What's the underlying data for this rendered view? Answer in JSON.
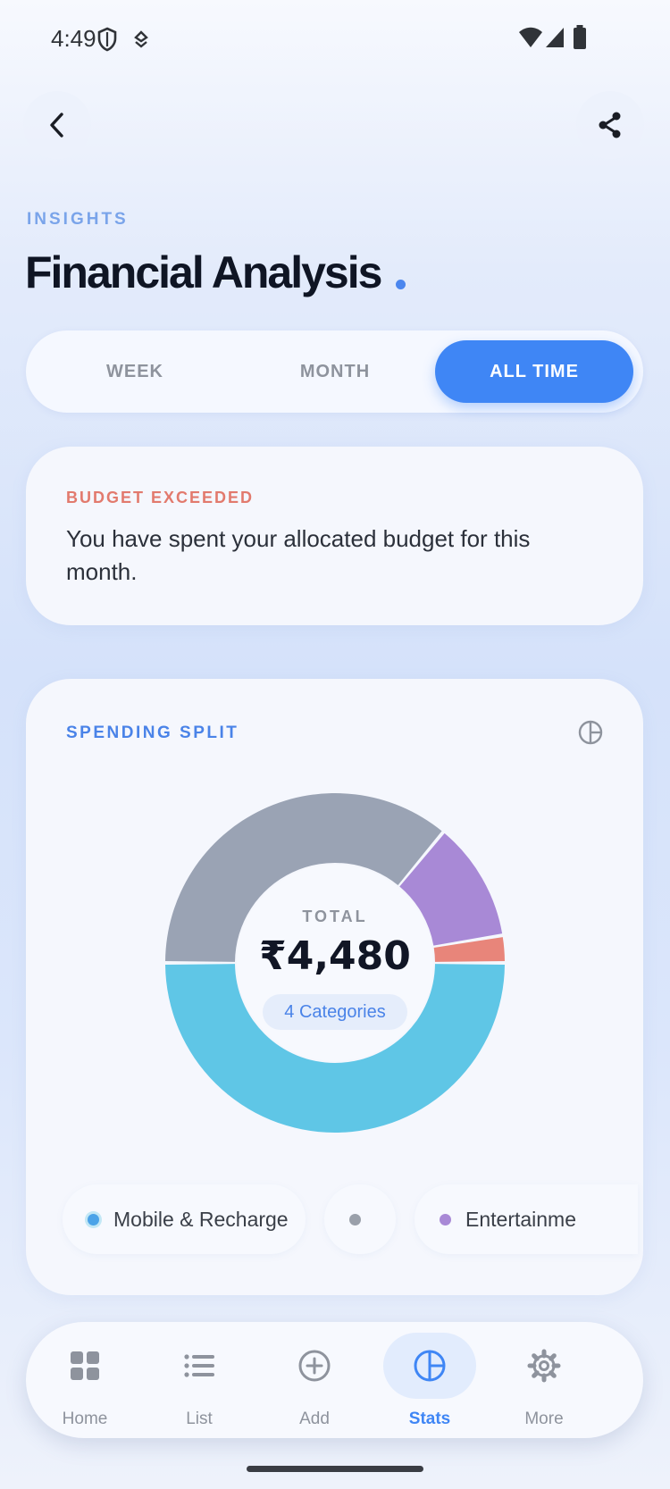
{
  "status_bar": {
    "time": "4:49"
  },
  "header": {
    "eyebrow": "INSIGHTS",
    "title": "Financial Analysis"
  },
  "period_tabs": [
    {
      "label": "WEEK",
      "active": false
    },
    {
      "label": "MONTH",
      "active": false
    },
    {
      "label": "ALL TIME",
      "active": true
    }
  ],
  "alert": {
    "title": "BUDGET EXCEEDED",
    "message": "You have spent your allocated budget for this month."
  },
  "spending": {
    "title": "SPENDING SPLIT",
    "total_label": "TOTAL",
    "total_value": "₹4,480",
    "categories_badge": "4 Categories",
    "legend": [
      {
        "label": "Mobile & Recharge",
        "color": "#5fc6e6"
      },
      {
        "label": "",
        "color": "#9aa3b4"
      },
      {
        "label": "Entertainme",
        "color": "#a889d6"
      }
    ]
  },
  "chart_data": {
    "type": "pie",
    "title": "SPENDING SPLIT",
    "variant": "donut",
    "total": "₹4,480",
    "slices": [
      {
        "label": "Mobile & Recharge",
        "share": 0.5,
        "color": "#5fc6e6"
      },
      {
        "label": "",
        "share": 0.36,
        "color": "#9aa3b4"
      },
      {
        "label": "Entertainme",
        "share": 0.114,
        "color": "#a889d6"
      },
      {
        "label": "",
        "share": 0.026,
        "color": "#e8857a"
      }
    ]
  },
  "nav": [
    {
      "label": "Home",
      "icon": "grid-icon",
      "active": false
    },
    {
      "label": "List",
      "icon": "list-icon",
      "active": false
    },
    {
      "label": "Add",
      "icon": "plus-circle-icon",
      "active": false
    },
    {
      "label": "Stats",
      "icon": "pie-chart-icon",
      "active": true
    },
    {
      "label": "More",
      "icon": "gear-icon",
      "active": false
    }
  ]
}
